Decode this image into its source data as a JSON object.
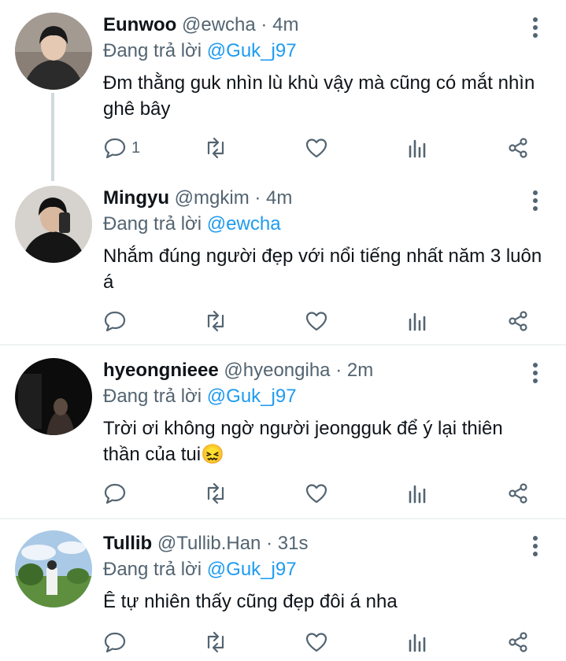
{
  "ui": {
    "reply_prefix": "Đang trả lời",
    "dot": "·"
  },
  "colors": {
    "mention": "#1d9bf0",
    "secondary_text": "#536471",
    "thread_line": "#cfd9de",
    "separator": "#eff3f4"
  },
  "tweets": [
    {
      "name": "Eunwoo",
      "handle": "@ewcha",
      "time": "4m",
      "reply_to": "@Guk_j97",
      "text": "Đm thằng guk nhìn lù khù vậy mà cũng có mắt nhìn ghê bây",
      "reply_count": "1"
    },
    {
      "name": "Mingyu",
      "handle": "@mgkim",
      "time": "4m",
      "reply_to": "@ewcha",
      "text": "Nhắm đúng người đẹp với nổi tiếng nhất năm 3 luôn á",
      "reply_count": ""
    },
    {
      "name": "hyeongnieee",
      "handle": "@hyeongiha",
      "time": "2m",
      "reply_to": "@Guk_j97",
      "text": "Trời ơi không ngờ người jeongguk để ý lại thiên thần của tui",
      "emoji": "😖",
      "reply_count": ""
    },
    {
      "name": "Tullib",
      "handle": "@Tullib.Han",
      "time": "31s",
      "reply_to": "@Guk_j97",
      "text": "Ê tự nhiên thấy cũng đẹp đôi á nha",
      "reply_count": ""
    }
  ],
  "icons": [
    "reply-icon",
    "retweet-icon",
    "like-icon",
    "views-icon",
    "share-icon",
    "more-options-icon"
  ]
}
